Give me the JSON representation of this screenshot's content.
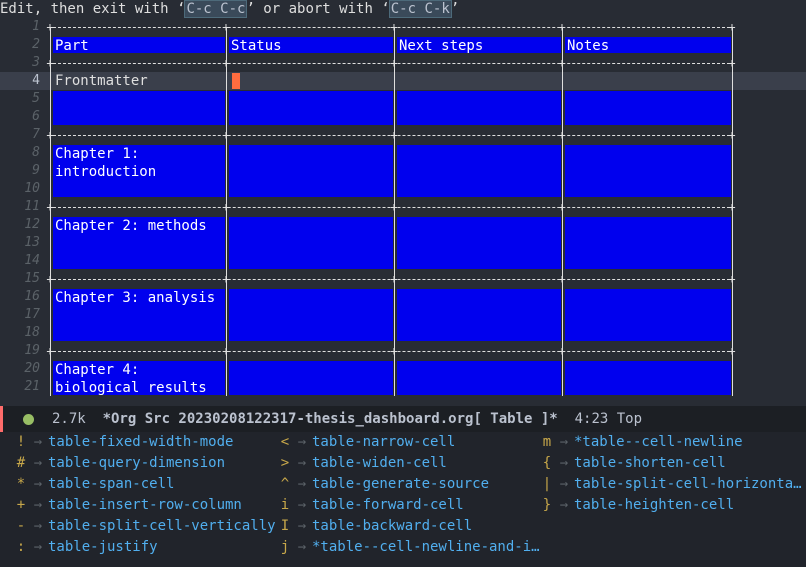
{
  "prompt": {
    "prefix": "Edit, then exit with ‘",
    "exit_key": "C-c C-c",
    "middle": "’ or abort with ‘",
    "abort_key": "C-c C-k",
    "suffix": "’"
  },
  "line_numbers": [
    "1",
    "2",
    "3",
    "4",
    "5",
    "6",
    "7",
    "8",
    "9",
    "10",
    "11",
    "12",
    "13",
    "14",
    "15",
    "16",
    "17",
    "18",
    "19",
    "20",
    "21"
  ],
  "current_line": "4",
  "table": {
    "headers": [
      "Part",
      "Status",
      "Next steps",
      "Notes"
    ],
    "rows": [
      {
        "part_lines": [
          "Frontmatter",
          "",
          ""
        ]
      },
      {
        "part_lines": [
          "Chapter 1:",
          "introduction",
          ""
        ]
      },
      {
        "part_lines": [
          "Chapter 2: methods",
          "",
          ""
        ]
      },
      {
        "part_lines": [
          "Chapter 3: analysis",
          "",
          ""
        ]
      },
      {
        "part_lines": [
          "Chapter 4:",
          "biological results",
          ""
        ]
      }
    ]
  },
  "modeline": {
    "size": "2.7k",
    "buffer": "*Org Src 20230208122317-thesis_dashboard.org[ Table ]*",
    "position": "4:23",
    "scroll": "Top",
    "indicator_color": "#98be65"
  },
  "which_key": {
    "arrow": "→",
    "columns": [
      [
        {
          "key": "!",
          "cmd": "table-fixed-width-mode"
        },
        {
          "key": "#",
          "cmd": "table-query-dimension"
        },
        {
          "key": "*",
          "cmd": "table-span-cell"
        },
        {
          "key": "+",
          "cmd": "table-insert-row-column"
        },
        {
          "key": "-",
          "cmd": "table-split-cell-vertically"
        },
        {
          "key": ":",
          "cmd": "table-justify"
        }
      ],
      [
        {
          "key": "<",
          "cmd": "table-narrow-cell"
        },
        {
          "key": ">",
          "cmd": "table-widen-cell"
        },
        {
          "key": "^",
          "cmd": "table-generate-source"
        },
        {
          "key": "i",
          "cmd": "table-forward-cell"
        },
        {
          "key": "I",
          "cmd": "table-backward-cell"
        },
        {
          "key": "j",
          "cmd": "*table--cell-newline-and-i…"
        }
      ],
      [
        {
          "key": "m",
          "cmd": "*table--cell-newline"
        },
        {
          "key": "{",
          "cmd": "table-shorten-cell"
        },
        {
          "key": "|",
          "cmd": "table-split-cell-horizonta…"
        },
        {
          "key": "}",
          "cmd": "table-heighten-cell"
        }
      ]
    ]
  }
}
